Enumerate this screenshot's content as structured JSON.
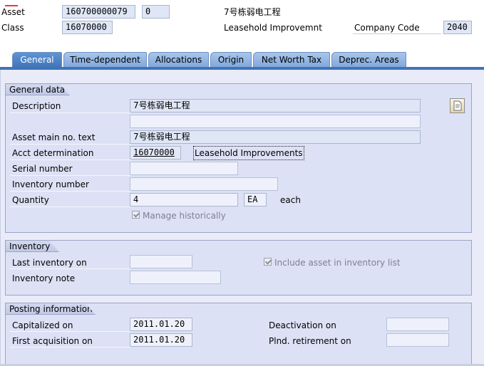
{
  "header": {
    "asset_label": "Asset",
    "asset_number": "160700000079",
    "sub_number": "0",
    "asset_description": "7号栋弱电工程",
    "class_label": "Class",
    "class_value": "16070000",
    "class_description": "Leasehold Improvemnt",
    "company_code_label": "Company Code",
    "company_code_value": "2040"
  },
  "tabs": [
    {
      "label": "General",
      "active": true
    },
    {
      "label": "Time-dependent",
      "active": false
    },
    {
      "label": "Allocations",
      "active": false
    },
    {
      "label": "Origin",
      "active": false
    },
    {
      "label": "Net Worth Tax",
      "active": false
    },
    {
      "label": "Deprec. Areas",
      "active": false
    }
  ],
  "general_data": {
    "title": "General data",
    "description_label": "Description",
    "description_1": "7号栋弱电工程",
    "description_2": "",
    "main_text_label": "Asset main no. text",
    "main_text_value": "7号栋弱电工程",
    "acct_label": "Acct determination",
    "acct_value": "16070000",
    "acct_description": "Leasehold Improvements",
    "serial_label": "Serial number",
    "serial_value": "",
    "inventory_number_label": "Inventory number",
    "inventory_number_value": "",
    "quantity_label": "Quantity",
    "quantity_value": "4",
    "unit_value": "EA",
    "unit_text": "each",
    "manage_hist_label": "Manage historically",
    "manage_hist_checked": true
  },
  "inventory": {
    "title": "Inventory",
    "last_inventory_label": "Last inventory on",
    "last_inventory_value": "",
    "include_label": "Include asset in inventory list",
    "include_checked": true,
    "note_label": "Inventory note",
    "note_value": ""
  },
  "posting": {
    "title": "Posting information",
    "capitalized_label": "Capitalized on",
    "capitalized_value": "2011.01.20",
    "deactivation_label": "Deactivation on",
    "deactivation_value": "",
    "first_acq_label": "First acquisition on",
    "first_acq_value": "2011.01.20",
    "retirement_label": "Plnd. retirement on",
    "retirement_value": ""
  },
  "colors": {
    "active_tab": "#3f74b8",
    "inactive_tab": "#8fb3e2",
    "panel_bg": "#dde1f5",
    "field_bg": "#dfe6f6"
  }
}
